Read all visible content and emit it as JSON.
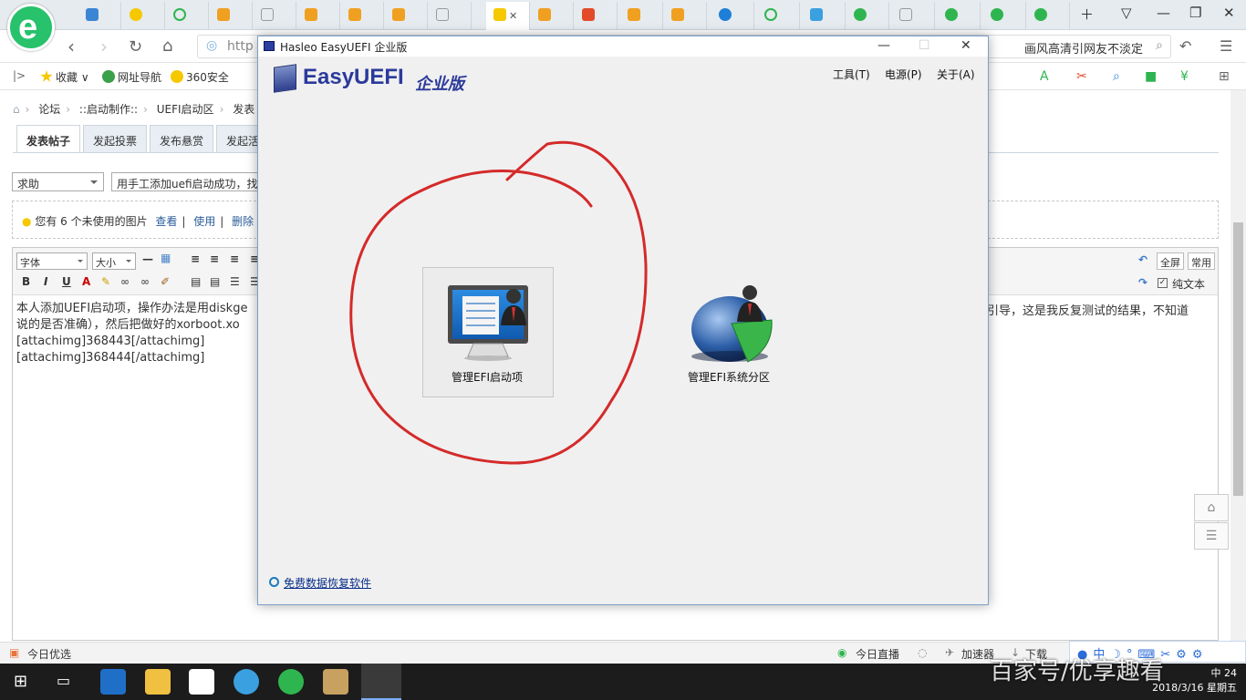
{
  "browser": {
    "tabs": [
      "",
      "",
      "",
      "",
      "",
      "",
      "",
      "",
      "",
      "",
      "",
      "",
      "",
      "",
      "",
      "",
      "",
      "",
      "",
      ""
    ],
    "url_prefix": "http",
    "url_tail": "画风高清引网友不淡定",
    "favorites": {
      "collect": "收藏",
      "nav": "网址导航",
      "safe": "360安全"
    }
  },
  "page": {
    "breadcrumb": [
      "论坛",
      "::启动制作::",
      "UEFI启动区",
      "发表"
    ],
    "tabs": [
      "发表帖子",
      "发起投票",
      "发布悬赏",
      "发起活"
    ],
    "category": "求助",
    "subject": "用手工添加uefi启动成功，找到",
    "images_notice": "您有 6 个未使用的图片",
    "img_view": "查看",
    "img_use": "使用",
    "img_delete": "删除",
    "font_select": "字体",
    "size_select": "大小",
    "fullscreen": "全屏",
    "common": "常用",
    "plain_text": "纯文本",
    "content_lines": [
      "本人添加UEFI启动项，操作办法是用diskge",
      "说的是否准确），然后把做好的xorboot.xo",
      "[attachimg]368443[/attachimg]",
      "[attachimg]368444[/attachimg]"
    ],
    "content_right": "引导，这是我反复测试的结果，不知道"
  },
  "statusbar": {
    "left": "今日优选",
    "live": "今日直播",
    "accel": "加速器",
    "download": "下载"
  },
  "ime": "中",
  "taskbar": {
    "time": "24",
    "date": "2018/3/16 星期五",
    "lang": "中"
  },
  "watermark": "百家号/优享趣看",
  "dialog": {
    "title": "Hasleo EasyUEFI 企业版",
    "app_name": "EasyUEFI",
    "app_edition": "企业版",
    "menu": [
      "工具(T)",
      "电源(P)",
      "关于(A)"
    ],
    "tile_boot": "管理EFI启动项",
    "tile_partition": "管理EFI系统分区",
    "footer_link": "免费数据恢复软件"
  }
}
